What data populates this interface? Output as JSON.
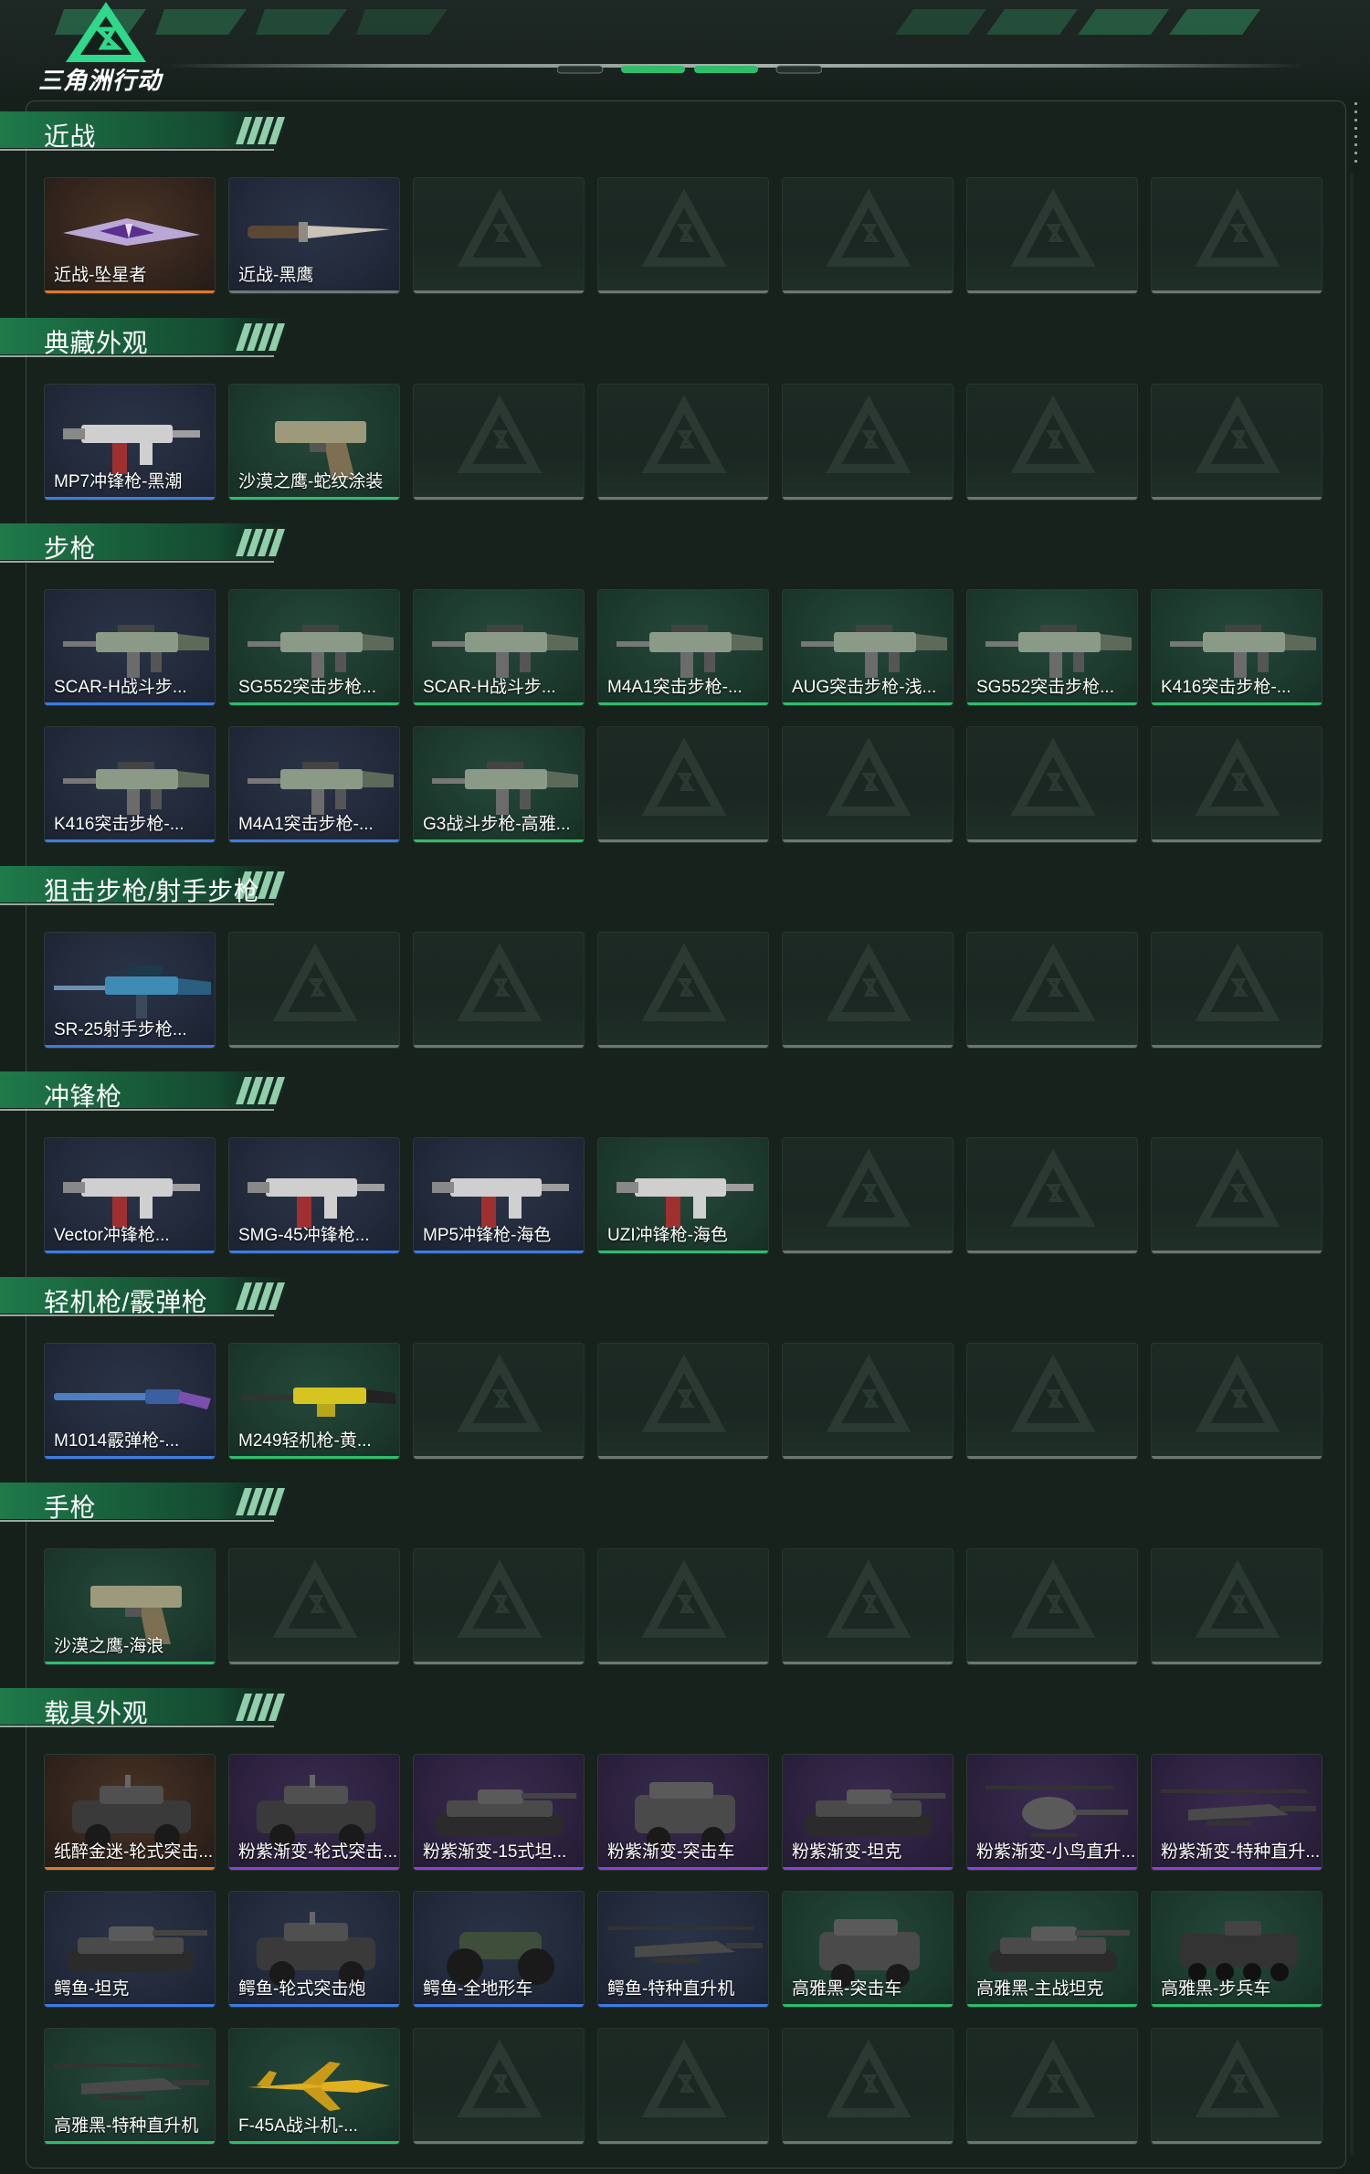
{
  "app": {
    "logo_text": "三角洲行动",
    "colors": {
      "background": "#16201b",
      "accent_green": "#2fbd6b",
      "rarity_blue": "#3f7be0",
      "rarity_orange": "#e07a2a",
      "rarity_purple": "#8a42d6",
      "empty_slot": "#6c7772"
    }
  },
  "sections": [
    {
      "title": "近战",
      "items": [
        {
          "label": "近战-坠星者",
          "rarity": "orange",
          "icon": "melee-blade-icon"
        },
        {
          "label": "近战-黑鹰",
          "rarity": "gray",
          "icon": "knife-icon"
        }
      ]
    },
    {
      "title": "典藏外观",
      "items": [
        {
          "label": "MP7冲锋枪-黑潮",
          "rarity": "blue",
          "icon": "smg-icon"
        },
        {
          "label": "沙漠之鹰-蛇纹涂装",
          "rarity": "green",
          "icon": "pistol-icon"
        }
      ]
    },
    {
      "title": "步枪",
      "items": [
        {
          "label": "SCAR-H战斗步...",
          "rarity": "blue",
          "icon": "rifle-icon"
        },
        {
          "label": "SG552突击步枪...",
          "rarity": "green",
          "icon": "rifle-icon"
        },
        {
          "label": "SCAR-H战斗步...",
          "rarity": "green",
          "icon": "rifle-icon"
        },
        {
          "label": "M4A1突击步枪-...",
          "rarity": "green",
          "icon": "rifle-icon"
        },
        {
          "label": "AUG突击步枪-浅...",
          "rarity": "green",
          "icon": "rifle-icon"
        },
        {
          "label": "SG552突击步枪...",
          "rarity": "green",
          "icon": "rifle-icon"
        },
        {
          "label": "K416突击步枪-...",
          "rarity": "green",
          "icon": "rifle-icon"
        },
        {
          "label": "K416突击步枪-...",
          "rarity": "blue",
          "icon": "rifle-icon"
        },
        {
          "label": "M4A1突击步枪-...",
          "rarity": "blue",
          "icon": "rifle-icon"
        },
        {
          "label": "G3战斗步枪-高雅...",
          "rarity": "green",
          "icon": "rifle-icon"
        }
      ]
    },
    {
      "title": "狙击步枪/射手步枪",
      "items": [
        {
          "label": "SR-25射手步枪...",
          "rarity": "blue",
          "icon": "sniper-icon"
        }
      ]
    },
    {
      "title": "冲锋枪",
      "items": [
        {
          "label": "Vector冲锋枪...",
          "rarity": "blue",
          "icon": "smg-icon"
        },
        {
          "label": "SMG-45冲锋枪...",
          "rarity": "blue",
          "icon": "smg-icon"
        },
        {
          "label": "MP5冲锋枪-海色",
          "rarity": "blue",
          "icon": "smg-icon"
        },
        {
          "label": "UZI冲锋枪-海色",
          "rarity": "green",
          "icon": "smg-icon"
        }
      ]
    },
    {
      "title": "轻机枪/霰弹枪",
      "items": [
        {
          "label": "M1014霰弹枪-...",
          "rarity": "blue",
          "icon": "shotgun-icon"
        },
        {
          "label": "M249轻机枪-黄...",
          "rarity": "green",
          "icon": "lmg-icon"
        }
      ]
    },
    {
      "title": "手枪",
      "items": [
        {
          "label": "沙漠之鹰-海浪",
          "rarity": "green",
          "icon": "pistol-icon"
        }
      ]
    },
    {
      "title": "载具外观",
      "items": [
        {
          "label": "纸醉金迷-轮式突击...",
          "rarity": "orange",
          "icon": "armored-car-icon"
        },
        {
          "label": "粉紫渐变-轮式突击...",
          "rarity": "purple",
          "icon": "armored-car-icon"
        },
        {
          "label": "粉紫渐变-15式坦...",
          "rarity": "purple",
          "icon": "tank-icon"
        },
        {
          "label": "粉紫渐变-突击车",
          "rarity": "purple",
          "icon": "assault-vehicle-icon"
        },
        {
          "label": "粉紫渐变-坦克",
          "rarity": "purple",
          "icon": "tank-icon"
        },
        {
          "label": "粉紫渐变-小鸟直升...",
          "rarity": "purple",
          "icon": "helicopter-icon"
        },
        {
          "label": "粉紫渐变-特种直升...",
          "rarity": "purple",
          "icon": "attack-helicopter-icon"
        },
        {
          "label": "鳄鱼-坦克",
          "rarity": "blue",
          "icon": "tank-icon"
        },
        {
          "label": "鳄鱼-轮式突击炮",
          "rarity": "blue",
          "icon": "armored-car-icon"
        },
        {
          "label": "鳄鱼-全地形车",
          "rarity": "blue",
          "icon": "atv-icon"
        },
        {
          "label": "鳄鱼-特种直升机",
          "rarity": "blue",
          "icon": "attack-helicopter-icon"
        },
        {
          "label": "高雅黑-突击车",
          "rarity": "green",
          "icon": "assault-vehicle-icon"
        },
        {
          "label": "高雅黑-主战坦克",
          "rarity": "green",
          "icon": "tank-icon"
        },
        {
          "label": "高雅黑-步兵车",
          "rarity": "green",
          "icon": "ifv-icon"
        },
        {
          "label": "高雅黑-特种直升机",
          "rarity": "green",
          "icon": "attack-helicopter-icon"
        },
        {
          "label": "F-45A战斗机-...",
          "rarity": "green",
          "icon": "fighter-jet-icon"
        }
      ]
    }
  ]
}
